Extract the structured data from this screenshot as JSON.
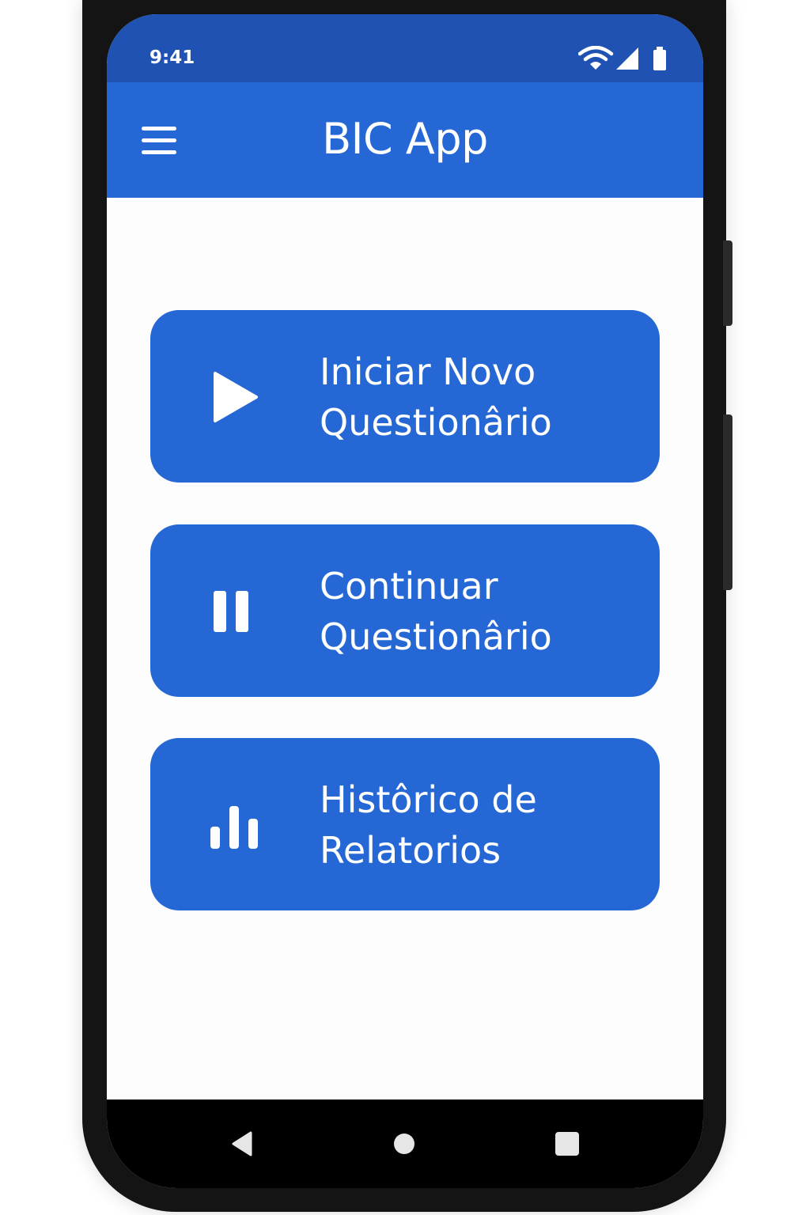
{
  "status_bar": {
    "time": "9:41",
    "icons": [
      "wifi-icon",
      "signal-icon",
      "battery-icon"
    ]
  },
  "app_bar": {
    "title": "BIC App",
    "menu_icon": "menu-icon"
  },
  "actions": [
    {
      "label": "Iniciar Novo\nQuestionârio",
      "icon": "play-icon"
    },
    {
      "label": "Continuar\nQuestionârio",
      "icon": "pause-icon"
    },
    {
      "label": "Histôrico de\nRelatorios",
      "icon": "bar-chart-icon"
    }
  ],
  "nav_bar": {
    "buttons": [
      "back-icon",
      "home-icon",
      "recents-icon"
    ]
  },
  "colors": {
    "primary": "#2467d5",
    "status_bar": "#1f52b3",
    "background": "#fdfdfd"
  }
}
